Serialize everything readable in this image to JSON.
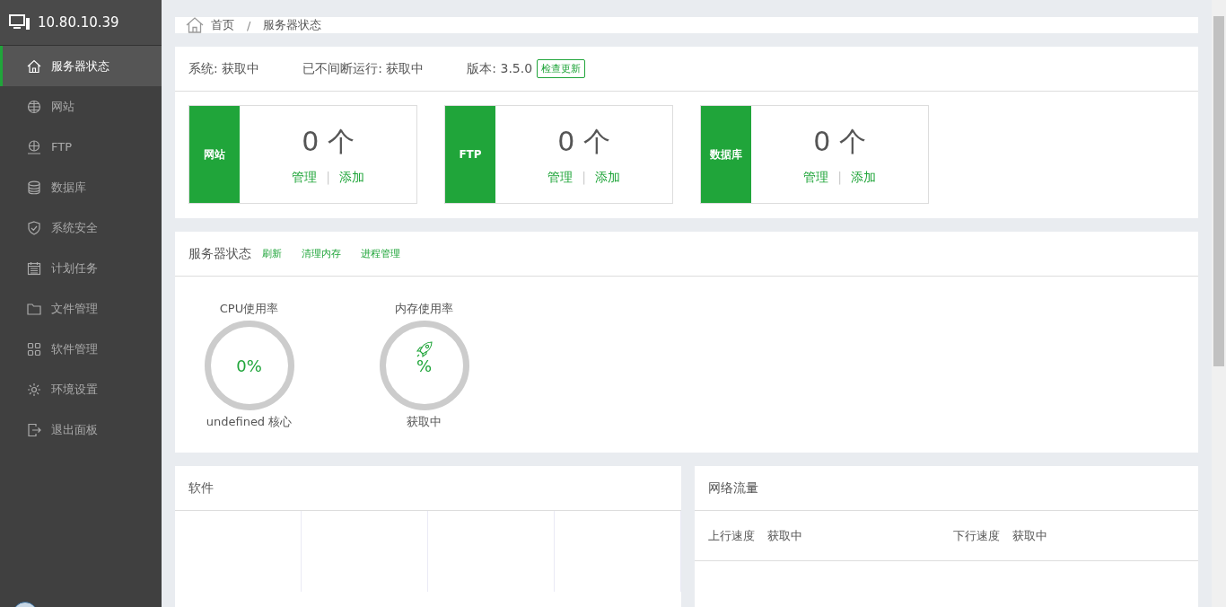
{
  "sidebar": {
    "host": "10.80.10.39",
    "items": [
      {
        "label": "服务器状态",
        "kind": "home",
        "selected": true
      },
      {
        "label": "网站",
        "kind": "globe",
        "selected": false
      },
      {
        "label": "FTP",
        "kind": "ftp",
        "selected": false
      },
      {
        "label": "数据库",
        "kind": "database",
        "selected": false
      },
      {
        "label": "系统安全",
        "kind": "shield",
        "selected": false
      },
      {
        "label": "计划任务",
        "kind": "calendar",
        "selected": false
      },
      {
        "label": "文件管理",
        "kind": "folder",
        "selected": false
      },
      {
        "label": "软件管理",
        "kind": "grid",
        "selected": false
      },
      {
        "label": "环境设置",
        "kind": "gear",
        "selected": false
      },
      {
        "label": "退出面板",
        "kind": "logout",
        "selected": false
      }
    ]
  },
  "breadcrumb": {
    "items": [
      "首页",
      "服务器状态"
    ],
    "separator": "/"
  },
  "summary": {
    "system": "系统: 获取中",
    "uptime": "已不间断运行: 获取中",
    "version": "版本: 3.5.0",
    "update_button": "检查更新"
  },
  "stat_boxes": [
    {
      "label": "网站",
      "count": "0 个",
      "links": [
        "管理",
        "添加"
      ],
      "separator": "|"
    },
    {
      "label": "FTP",
      "count": "0 个",
      "links": [
        "管理",
        "添加"
      ],
      "separator": "|"
    },
    {
      "label": "数据库",
      "count": "0 个",
      "links": [
        "管理",
        "添加"
      ],
      "separator": "|"
    }
  ],
  "server_status": {
    "title": "服务器状态",
    "actions": [
      "刷新",
      "清理内存",
      "进程管理"
    ],
    "gauges": [
      {
        "kind": "cpu",
        "title": "CPU使用率",
        "value": "0%",
        "caption": "undefined 核心"
      },
      {
        "kind": "memory",
        "title": "内存使用率",
        "value": "%",
        "caption": "获取中"
      }
    ]
  },
  "software": {
    "title": "软件"
  },
  "network": {
    "title": "网络流量",
    "rows": [
      [
        {
          "label": "上行速度",
          "value": "获取中"
        },
        {
          "label": "下行速度",
          "value": "获取中"
        }
      ]
    ]
  }
}
